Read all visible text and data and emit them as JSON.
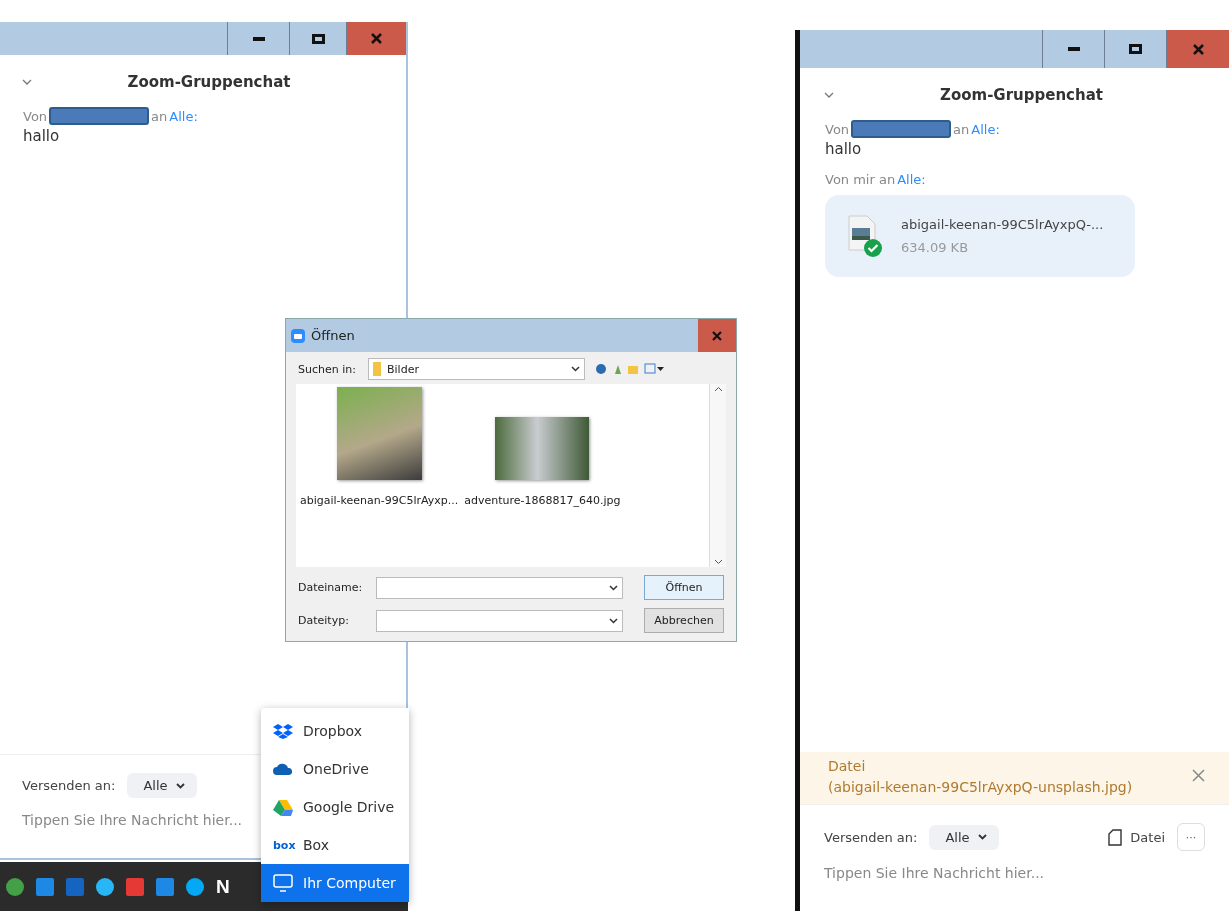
{
  "left_window": {
    "chat_title": "Zoom-Gruppenchat",
    "messages": [
      {
        "kind": "text",
        "from": "Von",
        "sender_redacted": true,
        "to": "an",
        "recipient": "Alle:",
        "text": "hallo"
      }
    ],
    "composer": {
      "send_to_label": "Versenden an:",
      "recipient": "Alle",
      "placeholder": "Tippen Sie Ihre Nachricht hier..."
    }
  },
  "taskbar": {
    "letter_icon": "N"
  },
  "share_menu": {
    "items": [
      {
        "kind": "dropbox",
        "label": "Dropbox",
        "selected": false
      },
      {
        "kind": "onedrive",
        "label": "OneDrive",
        "selected": false
      },
      {
        "kind": "gdrive",
        "label": "Google Drive",
        "selected": false
      },
      {
        "kind": "box",
        "label": "Box",
        "logo_text": "box",
        "selected": false
      },
      {
        "kind": "computer",
        "label": "Ihr Computer",
        "selected": true
      }
    ]
  },
  "open_dialog": {
    "title": "Öffnen",
    "look_in_label": "Suchen in:",
    "folder": "Bilder",
    "files": [
      {
        "kind": "portrait",
        "name": "abigail-keenan-99C5lrAyxp..."
      },
      {
        "kind": "landscape",
        "name": "adventure-1868817_640.jpg"
      }
    ],
    "filename_label": "Dateiname:",
    "filetype_label": "Dateityp:",
    "buttons": [
      "Öffnen",
      "Abbrechen"
    ]
  },
  "right_window": {
    "chat_title": "Zoom-Gruppenchat",
    "messages": [
      {
        "kind": "text",
        "from": "Von",
        "sender_redacted": true,
        "to": "an",
        "recipient": "Alle:",
        "text": "hallo"
      },
      {
        "kind": "file",
        "from": "Von mir an",
        "recipient": "Alle:",
        "file": {
          "name": "abigail-keenan-99C5lrAyxpQ-...",
          "size": "634.09 KB",
          "sent": true
        }
      }
    ],
    "attachment": {
      "label": "Datei",
      "file": "(abigail-keenan-99C5lrAyxpQ-unsplash.jpg)"
    },
    "composer": {
      "send_to_label": "Versenden an:",
      "recipient": "Alle",
      "file_button": "Datei",
      "more_button": "···",
      "placeholder": "Tippen Sie Ihre Nachricht hier..."
    }
  }
}
